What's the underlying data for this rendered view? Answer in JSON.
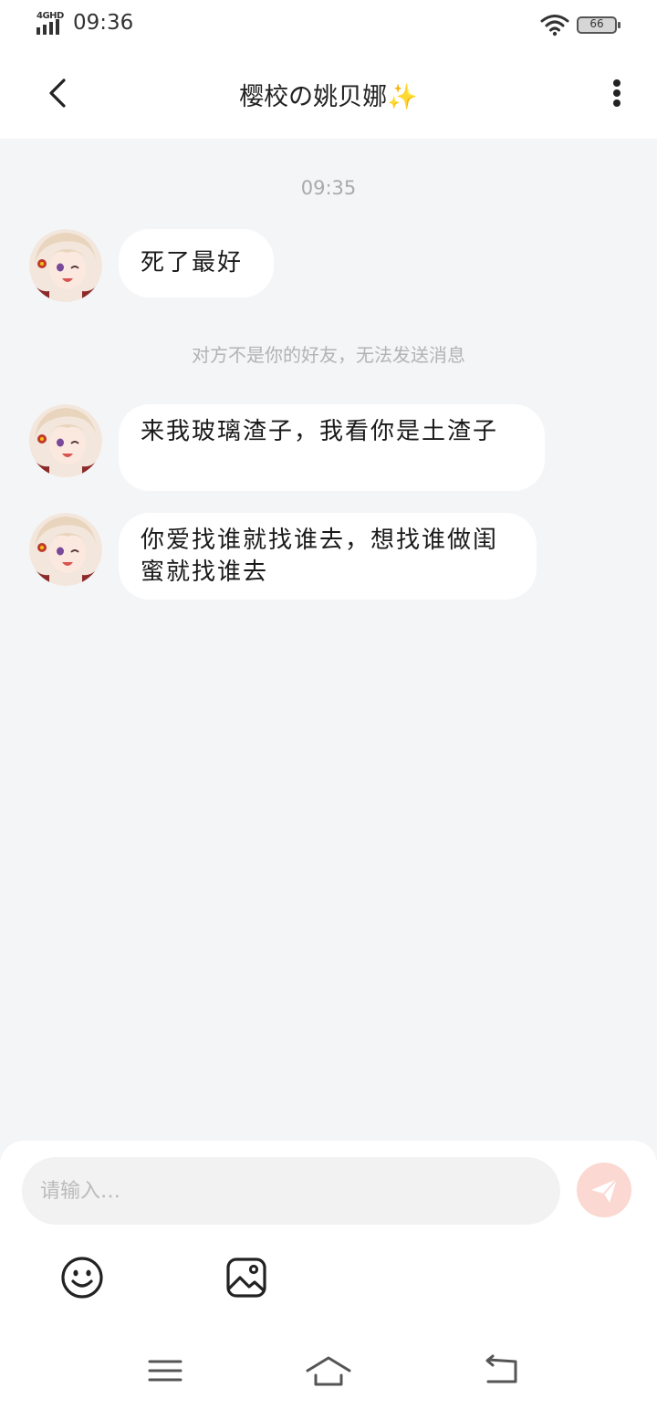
{
  "status_bar": {
    "network": "4GHD",
    "time": "09:36",
    "battery": "66"
  },
  "header": {
    "title": "樱校の姚贝娜✨"
  },
  "chat": {
    "timestamp": "09:35",
    "messages": [
      {
        "text": "死了最好"
      },
      {
        "text": " 来我玻璃渣子，我看你是土渣子"
      },
      {
        "text": "你爱找谁就找谁去，想找谁做闺蜜就找谁去"
      }
    ],
    "system_notice": "对方不是你的好友，无法发送消息"
  },
  "input": {
    "placeholder": "请输入…"
  },
  "colors": {
    "background": "#f4f5f7",
    "bubble": "#ffffff",
    "send_button": "#fbd8d2",
    "send_icon": "#ffffff"
  },
  "icons": {
    "back": "chevron-left-icon",
    "more": "more-vertical-icon",
    "send": "paper-plane-icon",
    "emoji": "smiley-icon",
    "image": "image-icon",
    "nav_menu": "menu-icon",
    "nav_home": "home-icon",
    "nav_back": "return-icon"
  }
}
